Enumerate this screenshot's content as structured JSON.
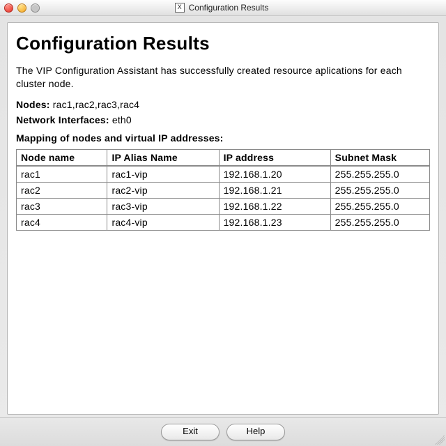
{
  "window": {
    "title": "Configuration Results"
  },
  "page": {
    "heading": "Configuration Results",
    "description": "The VIP Configuration Assistant has successfully created resource aplications for each cluster node.",
    "nodes_label": "Nodes:",
    "nodes_value": "rac1,rac2,rac3,rac4",
    "interfaces_label": "Network Interfaces:",
    "interfaces_value": "eth0",
    "mapping_heading": "Mapping of nodes and virtual IP addresses:"
  },
  "table": {
    "headers": {
      "node": "Node name",
      "alias": "IP Alias Name",
      "ip": "IP address",
      "mask": "Subnet Mask"
    },
    "rows": [
      {
        "node": "rac1",
        "alias": "rac1-vip",
        "ip": "192.168.1.20",
        "mask": "255.255.255.0"
      },
      {
        "node": "rac2",
        "alias": "rac2-vip",
        "ip": "192.168.1.21",
        "mask": "255.255.255.0"
      },
      {
        "node": "rac3",
        "alias": "rac3-vip",
        "ip": "192.168.1.22",
        "mask": "255.255.255.0"
      },
      {
        "node": "rac4",
        "alias": "rac4-vip",
        "ip": "192.168.1.23",
        "mask": "255.255.255.0"
      }
    ]
  },
  "buttons": {
    "exit": "Exit",
    "help": "Help"
  }
}
